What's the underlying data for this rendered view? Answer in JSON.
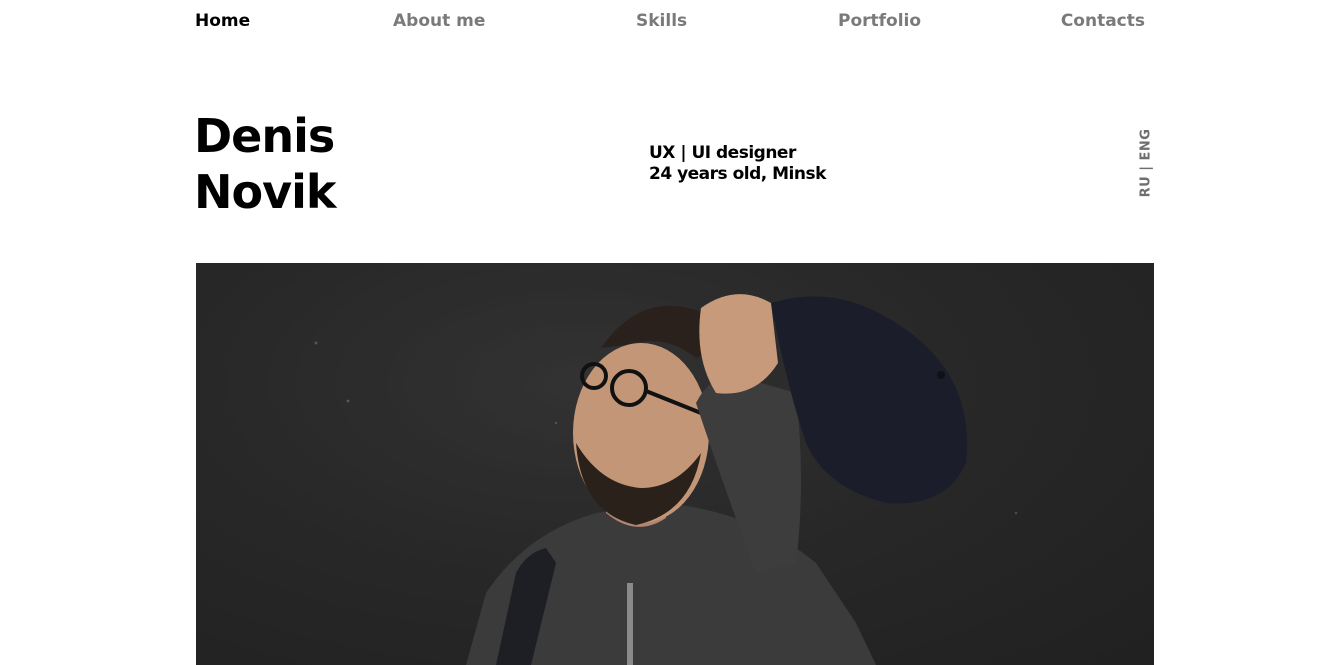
{
  "nav": {
    "items": [
      {
        "label": "Home",
        "active": true
      },
      {
        "label": "About me",
        "active": false
      },
      {
        "label": "Skills",
        "active": false
      },
      {
        "label": "Portfolio",
        "active": false
      },
      {
        "label": "Contacts",
        "active": false
      }
    ]
  },
  "hero": {
    "first_name": "Denis",
    "last_name": "Novik",
    "role": "UX | UI designer",
    "details": "24 years old, Minsk"
  },
  "language_switch": {
    "label": "RU | ENG"
  },
  "photo": {
    "icon": "portrait-photo"
  },
  "colors": {
    "active_nav": "#000000",
    "inactive_nav": "#7a7a7a",
    "background": "#ffffff",
    "photo_background": "#2a2a2a"
  }
}
